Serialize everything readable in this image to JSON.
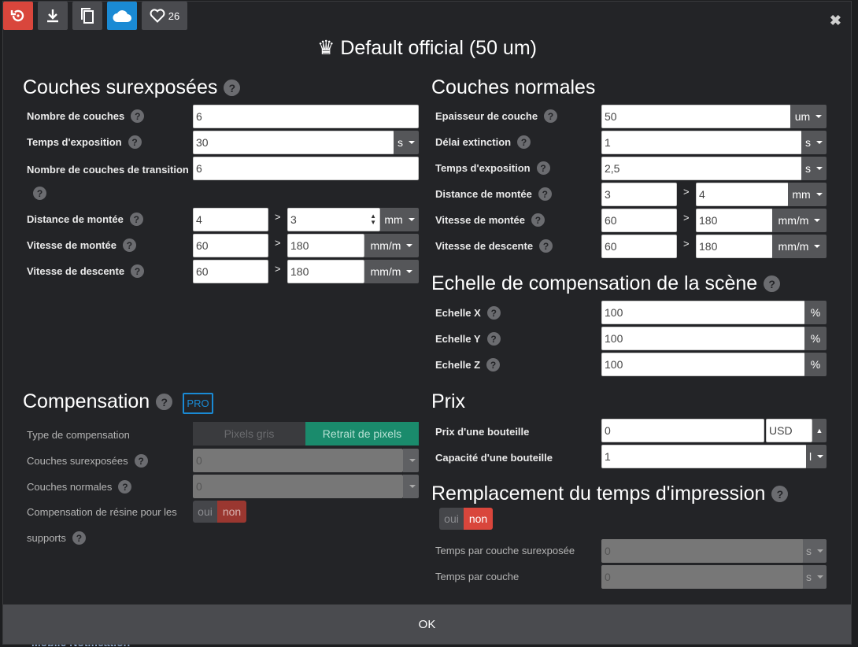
{
  "toolbar": {
    "like_count": "26"
  },
  "dialog_title": "♛ Default official (50 um)",
  "left": {
    "section_title": "Couches surexposées",
    "rows": {
      "nb_couches": {
        "label": "Nombre de couches",
        "value": "6"
      },
      "temps_exposition": {
        "label": "Temps d'exposition",
        "value": "30",
        "unit": "s"
      },
      "nb_transition": {
        "label": "Nombre de couches de transition",
        "value": "6"
      },
      "distance_montee": {
        "label": "Distance de montée",
        "value1": "4",
        "value2": "3",
        "unit": "mm"
      },
      "vitesse_montee": {
        "label": "Vitesse de montée",
        "value1": "60",
        "value2": "180",
        "unit": "mm/m"
      },
      "vitesse_descente": {
        "label": "Vitesse de descente",
        "value1": "60",
        "value2": "180",
        "unit": "mm/m"
      }
    }
  },
  "compensation": {
    "section_title": "Compensation",
    "badge": "PRO",
    "type_label": "Type de compensation",
    "opt1": "Pixels gris",
    "opt2": "Retrait de pixels",
    "couches_sur_label": "Couches surexposées",
    "couches_sur_value": "0",
    "couches_norm_label": "Couches normales",
    "couches_norm_value": "0",
    "resine_label_1": "Compensation de résine pour les",
    "resine_label_2": "supports",
    "oui": "oui",
    "non": "non"
  },
  "right": {
    "section_title": "Couches normales",
    "rows": {
      "epaisseur": {
        "label": "Epaisseur de couche",
        "value": "50",
        "unit": "um"
      },
      "delai": {
        "label": "Délai extinction",
        "value": "1",
        "unit": "s"
      },
      "temps": {
        "label": "Temps d'exposition",
        "value": "2,5",
        "unit": "s"
      },
      "distance": {
        "label": "Distance de montée",
        "value1": "3",
        "value2": "4",
        "unit": "mm"
      },
      "vmontee": {
        "label": "Vitesse de montée",
        "value1": "60",
        "value2": "180",
        "unit": "mm/m"
      },
      "vdescente": {
        "label": "Vitesse de descente",
        "value1": "60",
        "value2": "180",
        "unit": "mm/m"
      }
    }
  },
  "echelle": {
    "section_title": "Echelle de compensation de la scène",
    "x_label": "Echelle X",
    "x_value": "100",
    "y_label": "Echelle Y",
    "y_value": "100",
    "z_label": "Echelle Z",
    "z_value": "100",
    "unit": "%"
  },
  "prix": {
    "section_title": "Prix",
    "bouteille_label": "Prix d'une bouteille",
    "bouteille_value": "0",
    "currency": "USD",
    "capacite_label": "Capacité d'une bouteille",
    "capacite_value": "1",
    "capacite_unit": "l"
  },
  "remplacement": {
    "section_title": "Remplacement du temps d'impression",
    "oui": "oui",
    "non": "non",
    "temps_sur_label": "Temps par couche surexposée",
    "temps_sur_value": "0",
    "temps_label": "Temps par couche",
    "temps_value": "0",
    "unit": "s"
  },
  "ok_label": "OK",
  "behind_text": "Mobile Notification"
}
